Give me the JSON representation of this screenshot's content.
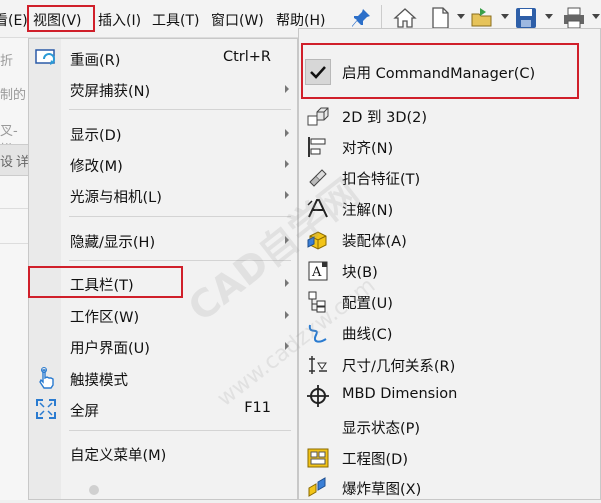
{
  "menubar": {
    "items": [
      "看(E)",
      "视图(V)",
      "插入(I)",
      "工具(T)",
      "窗口(W)",
      "帮助(H)"
    ]
  },
  "left_strip": {
    "texts": [
      "折",
      "制的",
      "叉-拱",
      "设",
      "详"
    ]
  },
  "view_menu": {
    "items": [
      {
        "label": "重画(R)",
        "shortcut": "Ctrl+R",
        "icon": "redraw-icon"
      },
      {
        "label": "荧屏捕获(N)",
        "submenu": true
      },
      {
        "label": "显示(D)",
        "submenu": true
      },
      {
        "label": "修改(M)",
        "submenu": true
      },
      {
        "label": "光源与相机(L)",
        "submenu": true
      },
      {
        "label": "隐藏/显示(H)",
        "submenu": true
      },
      {
        "label": "工具栏(T)",
        "submenu": true,
        "highlighted": true
      },
      {
        "label": "工作区(W)",
        "submenu": true
      },
      {
        "label": "用户界面(U)",
        "submenu": true
      },
      {
        "label": "触摸模式",
        "icon": "touch-hand-icon"
      },
      {
        "label": "全屏",
        "shortcut": "F11",
        "icon": "fullscreen-icon"
      },
      {
        "label": "自定义菜单(M)"
      }
    ]
  },
  "toolbar_menu": {
    "items": [
      {
        "label": "启用 CommandManager(C)",
        "checked": true,
        "highlighted": true
      },
      {
        "label": "2D 到 3D(2)",
        "icon": "2d-to-3d-icon"
      },
      {
        "label": "对齐(N)",
        "icon": "align-icon"
      },
      {
        "label": "扣合特征(T)",
        "icon": "fastening-feature-icon"
      },
      {
        "label": "注解(N)",
        "icon": "annotation-icon"
      },
      {
        "label": "装配体(A)",
        "icon": "assembly-icon"
      },
      {
        "label": "块(B)",
        "icon": "block-icon"
      },
      {
        "label": "配置(U)",
        "icon": "configuration-icon"
      },
      {
        "label": "曲线(C)",
        "icon": "curve-icon"
      },
      {
        "label": "尺寸/几何关系(R)",
        "icon": "dimension-relation-icon"
      },
      {
        "label": "MBD Dimension",
        "icon": "mbd-dimension-icon"
      },
      {
        "label": "显示状态(P)"
      },
      {
        "label": "工程图(D)",
        "icon": "drawing-icon"
      },
      {
        "label": "爆炸草图(X)",
        "icon": "explode-sketch-icon"
      }
    ]
  },
  "watermark": {
    "text": "CAD自学网",
    "url_text": "www.cadzxw.com"
  },
  "colors": {
    "highlight_border": "#d01f2a",
    "menu_bg": "#f2f2f2"
  }
}
